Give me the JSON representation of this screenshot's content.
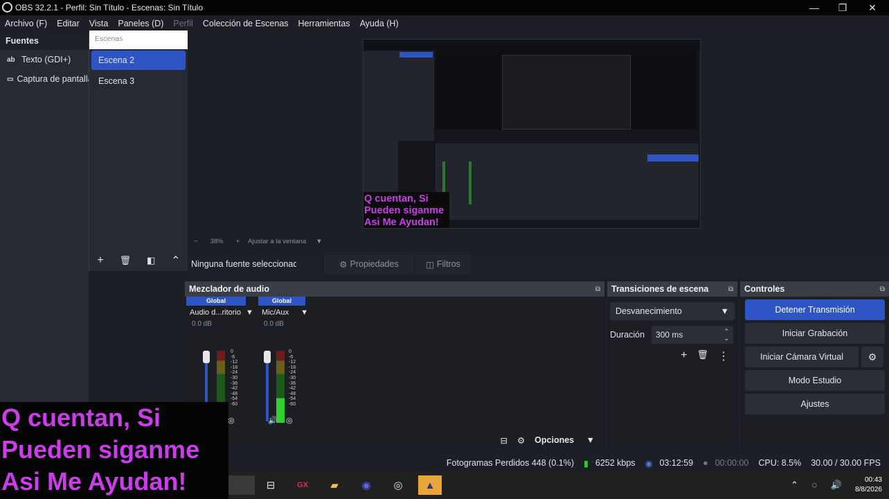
{
  "window": {
    "title": "OBS 32.2.1 - Perfil: Sin Título - Escenas: Sin Título",
    "minimize": "—",
    "restore": "❐",
    "close": "✕"
  },
  "menu": [
    {
      "label": "Archivo (F)",
      "dim": false
    },
    {
      "label": "Editar",
      "dim": false
    },
    {
      "label": "Vista",
      "dim": false
    },
    {
      "label": "Paneles (D)",
      "dim": false
    },
    {
      "label": "Perfil",
      "dim": true
    },
    {
      "label": "Colección de Escenas",
      "dim": false
    },
    {
      "label": "Herramientas",
      "dim": false
    },
    {
      "label": "Ayuda (H)",
      "dim": false
    }
  ],
  "sources": {
    "title": "Fuentes",
    "items": [
      {
        "icon": "ab",
        "label": "Texto (GDI+)"
      },
      {
        "icon": "▭",
        "label": "Captura de pantalla"
      }
    ]
  },
  "scenes": {
    "search_placeholder": "Escenas",
    "items": [
      {
        "label": "Escena 2",
        "selected": true
      },
      {
        "label": "Escena 3",
        "selected": false
      }
    ],
    "toolbar": {
      "add": "+",
      "remove": "🗑",
      "filter": "◧",
      "up": "⌃"
    }
  },
  "preview": {
    "overlay_text": "Q cuentan, Si Pueden siganme Asi Me Ayudan!",
    "zoom": "38%",
    "zoom_minus": "−",
    "zoom_plus": "+",
    "fit_label": "Ajustar a la ventana"
  },
  "props_bar": {
    "no_source": "Ninguna fuente seleccionada",
    "properties": "Propiedades",
    "filters": "Filtros"
  },
  "mixer": {
    "title": "Mezclador de audio",
    "channels": [
      {
        "global": "Global",
        "name": "Audio d...ritorio",
        "db": "0.0 dB"
      },
      {
        "global": "Global",
        "name": "Mic/Aux",
        "db": "0.0 dB"
      }
    ],
    "scale": [
      "0",
      "-6",
      "-12",
      "-18",
      "-24",
      "-30",
      "-36",
      "-42",
      "-48",
      "-54",
      "-60"
    ],
    "options": "Opciones"
  },
  "transitions": {
    "title": "Transiciones de escena",
    "type": "Desvanecimiento",
    "duration_label": "Duración",
    "duration_value": "300 ms"
  },
  "controls": {
    "title": "Controles",
    "stop_stream": "Detener Transmisión",
    "start_recording": "Iniciar Grabación",
    "start_virtual_cam": "Iniciar Cámara Virtual",
    "studio_mode": "Modo Estudio",
    "settings": "Ajustes"
  },
  "status": {
    "dropped_frames": "Fotogramas Perdidos 448 (0.1%)",
    "bitrate": "6252 kbps",
    "stream_time": "03:12:59",
    "rec_time": "00:00:00",
    "cpu": "CPU: 8.5%",
    "fps": "30.00 / 30.00 FPS"
  },
  "overlay": {
    "line1": "Q cuentan, Si",
    "line2": "Pueden siganme",
    "line3": "Asi Me Ayudan!"
  },
  "taskbar": {
    "time": "00:43",
    "date": "8/8/2026"
  },
  "colors": {
    "accent": "#2f55c4",
    "overlay_text": "#c93ee8"
  }
}
